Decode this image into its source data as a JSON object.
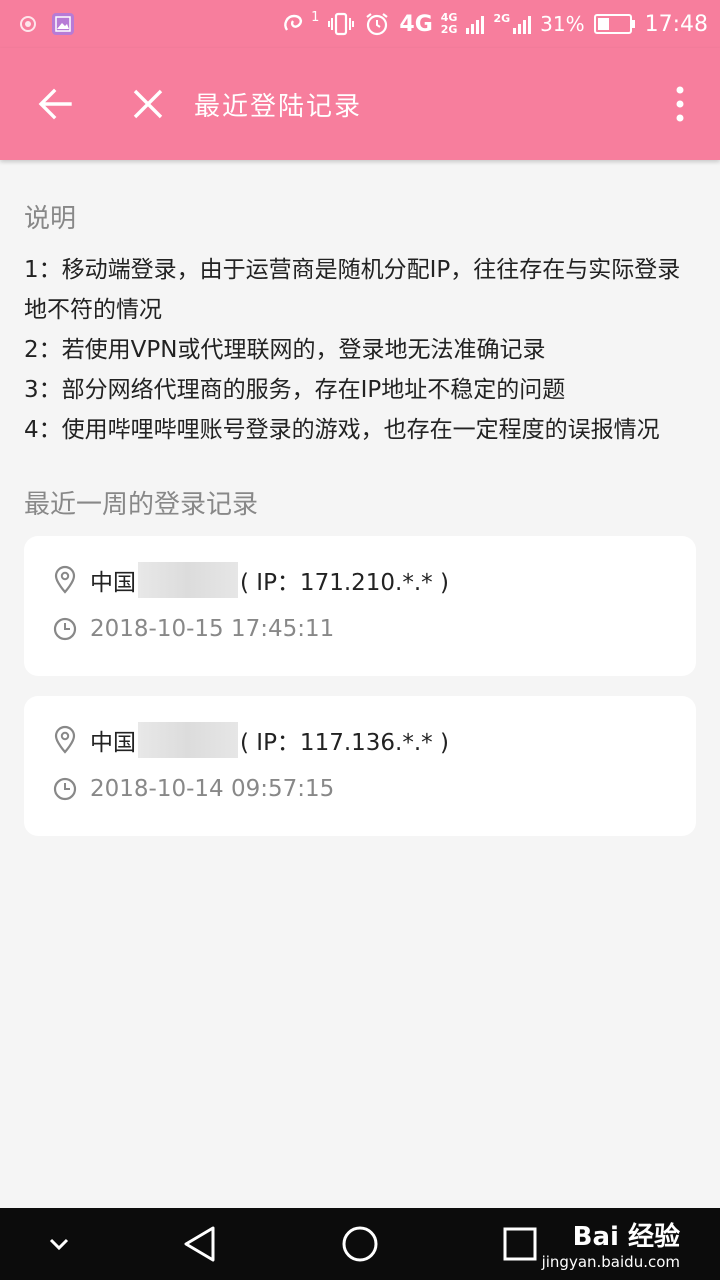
{
  "status_bar": {
    "signal_label": "4G",
    "network_small_top": "4G",
    "network_small_bottom": "2G",
    "network2": "2G",
    "battery_percent": "31%",
    "time": "17:48",
    "notif_count": "1"
  },
  "app_bar": {
    "title": "最近登陆记录",
    "icons": [
      "arrow-left-icon",
      "close-icon",
      "more-vertical-icon"
    ]
  },
  "description": {
    "title": "说明",
    "items": [
      "1：移动端登录，由于运营商是随机分配IP，往往存在与实际登录地不符的情况",
      "2：若使用VPN或代理联网的，登录地无法准确记录",
      "3：部分网络代理商的服务，存在IP地址不稳定的问题",
      "4：使用哔哩哔哩账号登录的游戏，也存在一定程度的误报情况"
    ]
  },
  "records": {
    "title": "最近一周的登录记录",
    "list": [
      {
        "location_prefix": "中国",
        "ip_text": "( IP：171.210.*.* )",
        "time": "2018-10-15 17:45:11"
      },
      {
        "location_prefix": "中国",
        "ip_text": "( IP：117.136.*.* )",
        "time": "2018-10-14 09:57:15"
      }
    ]
  },
  "watermark": {
    "brand": "Bai 经验",
    "url": "jingyan.baidu.com"
  },
  "colors": {
    "accent": "#f77e9d",
    "background": "#f5f5f5",
    "secondary_text": "#888888",
    "nav_bar": "#0c0c0c"
  }
}
